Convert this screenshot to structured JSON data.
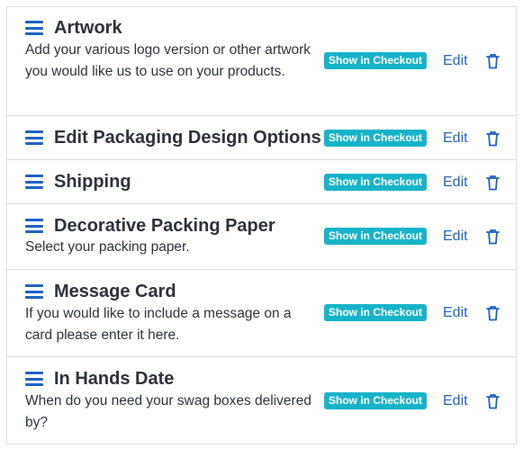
{
  "items": [
    {
      "title": "Artwork",
      "description": "Add your various logo version or other artwork you would like us to use on your products.",
      "badge": "Show in Checkout",
      "edit": "Edit"
    },
    {
      "title": "Edit Packaging Design Options",
      "description": "",
      "badge": "Show in Checkout",
      "edit": "Edit"
    },
    {
      "title": "Shipping",
      "description": "",
      "badge": "Show in Checkout",
      "edit": "Edit"
    },
    {
      "title": "Decorative Packing Paper",
      "description": "Select your packing paper.",
      "badge": "Show in Checkout",
      "edit": "Edit"
    },
    {
      "title": "Message Card",
      "description": "If you would like to include a message on a card please enter it here.",
      "badge": "Show in Checkout",
      "edit": "Edit"
    },
    {
      "title": "In Hands Date",
      "description": "When do you need your swag boxes delivered by?",
      "badge": "Show in Checkout",
      "edit": "Edit"
    }
  ],
  "icons": {
    "drag": "hamburger-menu-icon",
    "delete": "trash-icon"
  },
  "colors": {
    "accent": "#1f5fbf",
    "badge": "#17b3c9",
    "text": "#2b2f38",
    "border": "#dcdfe3"
  }
}
